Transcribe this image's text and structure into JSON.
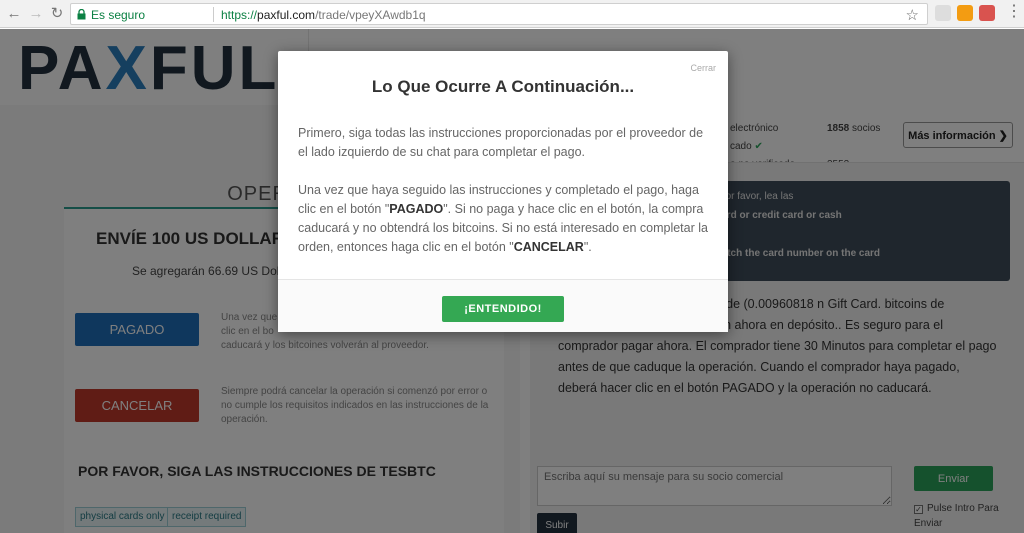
{
  "browser": {
    "secure_label": "Es seguro",
    "url_scheme": "https://",
    "url_host": "paxful.com",
    "url_path": "/trade/vpeyXAwdb1q",
    "back_icon": "←",
    "forward_icon": "→",
    "reload_icon": "↻",
    "star_icon": "☆",
    "menu_icon": "⋮"
  },
  "header": {
    "logo_before": "PA",
    "logo_x": "X",
    "logo_after": "FUL"
  },
  "left": {
    "ops_title": "OPERACIÓ",
    "send_title": "ENVÍE 100 US DOLLARS C",
    "send_sub": "Se agregarán 66.69 US Doll",
    "pagado_label": "PAGADO",
    "pagado_note": "Una vez que\nclic en el bo\ncaducará y los bitcoines volverán al proveedor.",
    "cancelar_label": "CANCELAR",
    "cancel_note": "Siempre podrá cancelar la operación si comenzó por error o no cumple los requisitos indicados en las instrucciones de la operación.",
    "follow_title": "POR FAVOR, SIGA LAS INSTRUCCIONES DE TESBTC",
    "tags": [
      "physical cards only",
      "receipt required"
    ]
  },
  "right": {
    "stat1_label": "electrónico",
    "stat1_value": "1858",
    "stat1_unit": "socios",
    "stat2_label": "cado",
    "stat2_check": "✔",
    "stat3_label": "o no verificado",
    "stat3_value": "2552",
    "more_info": "Más información ❯",
    "terms_lines": [
      "edor, por favor, lea las",
      "ebit card or credit card or cash",
      "uld match the card number on the card"
    ],
    "deposit_text": "USD por 66.68 USD por valor de (0.00960818 n Gift Card. bitcoins de 0.00960818 (66.68 USD) están ahora en depósito.. Es seguro para el comprador pagar ahora. El comprador tiene 30 Minutos para completar el pago antes de que caduque la operación. Cuando el comprador haya pagado, deberá hacer clic en el botón PAGADO y la operación no caducará.",
    "message_placeholder": "Escriba aquí su mensaje para su socio comercial",
    "send_label": "Enviar",
    "pulse_label": "Pulse Intro Para Enviar",
    "upload_label": "Subir"
  },
  "modal": {
    "close_label": "Cerrar",
    "title": "Lo Que Ocurre A Continuación...",
    "para1": "Primero, siga todas las instrucciones proporcionadas por el proveedor de el lado izquierdo de su chat para completar el pago.",
    "para2_a": "Una vez que haya seguido las instrucciones y completado el pago, haga clic en el botón \"",
    "para2_b": "PAGADO",
    "para2_c": "\". Si no paga y hace clic en el botón, la compra caducará y no obtendrá los bitcoins. Si no está interesado en completar la orden, entonces haga clic en el botón \"",
    "para2_d": "CANCELAR",
    "para2_e": "\".",
    "confirm_label": "¡ENTENDIDO!"
  },
  "colors": {
    "pagado": "#1f6fba",
    "cancelar": "#c0392b",
    "confirm": "#34a853",
    "secure": "#0b8043"
  }
}
